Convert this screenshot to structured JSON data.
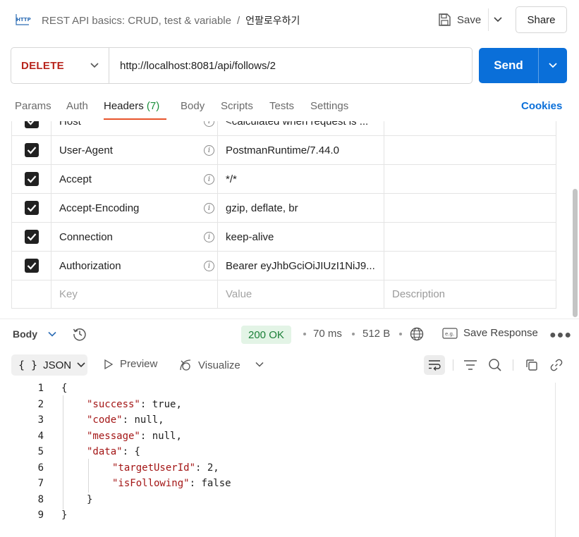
{
  "header": {
    "collection": "REST API basics: CRUD, test & variable",
    "separator": "/",
    "request_name": "언팔로우하기",
    "save_label": "Save",
    "share_label": "Share"
  },
  "request": {
    "method": "DELETE",
    "url": "http://localhost:8081/api/follows/2",
    "send_label": "Send"
  },
  "tabs": [
    {
      "label": "Params"
    },
    {
      "label": "Auth"
    },
    {
      "label": "Headers",
      "count": "(7)",
      "active": true
    },
    {
      "label": "Body"
    },
    {
      "label": "Scripts"
    },
    {
      "label": "Tests"
    },
    {
      "label": "Settings"
    }
  ],
  "cookies_label": "Cookies",
  "headers_table": {
    "rows": [
      {
        "key": "Host",
        "value": "<calculated when request is ...",
        "checked": true
      },
      {
        "key": "User-Agent",
        "value": "PostmanRuntime/7.44.0",
        "checked": true
      },
      {
        "key": "Accept",
        "value": "*/*",
        "checked": true
      },
      {
        "key": "Accept-Encoding",
        "value": "gzip, deflate, br",
        "checked": true
      },
      {
        "key": "Connection",
        "value": "keep-alive",
        "checked": true
      },
      {
        "key": "Authorization",
        "value": "Bearer eyJhbGciOiJIUzI1NiJ9...",
        "checked": true
      }
    ],
    "placeholder": {
      "key": "Key",
      "value": "Value",
      "description": "Description"
    }
  },
  "response": {
    "body_label": "Body",
    "status": "200 OK",
    "time": "70 ms",
    "size": "512 B",
    "save_response_label": "Save Response",
    "save_response_badge": "e.g.",
    "format": "JSON",
    "format_braces": "{ }",
    "preview_label": "Preview",
    "visualize_label": "Visualize",
    "status_color": "#1a7f37"
  },
  "code_lines": [
    {
      "n": "1",
      "text": "{"
    },
    {
      "n": "2",
      "text": "\"success\": true,"
    },
    {
      "n": "3",
      "text": "\"code\": null,"
    },
    {
      "n": "4",
      "text": "\"message\": null,"
    },
    {
      "n": "5",
      "text": "\"data\": {"
    },
    {
      "n": "6",
      "text": "\"targetUserId\": 2,"
    },
    {
      "n": "7",
      "text": "\"isFollowing\": false"
    },
    {
      "n": "8",
      "text": "}"
    },
    {
      "n": "9",
      "text": "}"
    }
  ],
  "icons": [
    "http-icon",
    "save-icon",
    "chevron-down-icon",
    "info-icon",
    "checkbox-checked-icon",
    "history-icon",
    "globe-icon",
    "save-response-icon",
    "more-icon",
    "preview-play-icon",
    "visualize-icon",
    "wrap-lines-icon",
    "filter-icon",
    "search-icon",
    "copy-icon",
    "link-icon"
  ]
}
